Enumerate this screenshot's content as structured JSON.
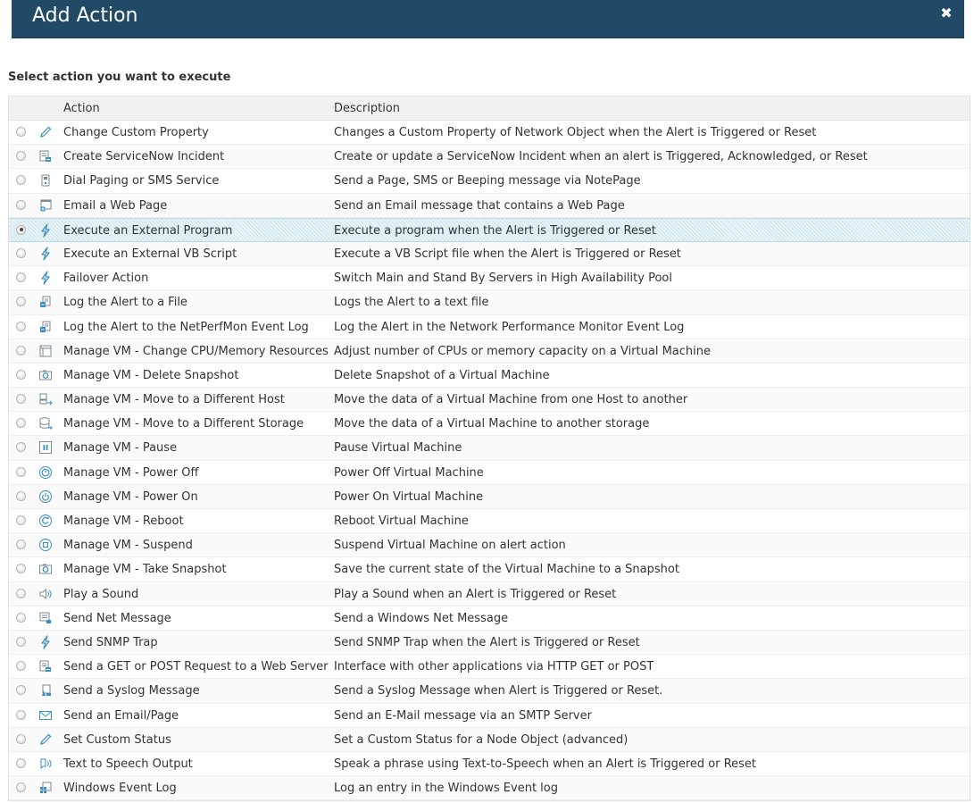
{
  "dialog": {
    "title": "Add Action",
    "close_icon": "close-icon",
    "instruction": "Select action you want to execute"
  },
  "table": {
    "columns": {
      "action": "Action",
      "description": "Description"
    },
    "selected_index": 4,
    "rows": [
      {
        "action": "Change Custom Property",
        "description": "Changes a Custom Property of Network Object when the Alert is Triggered or Reset",
        "icon": "pencil-icon"
      },
      {
        "action": "Create ServiceNow Incident",
        "description": "Create or update a ServiceNow Incident when an alert is Triggered, Acknowledged, or Reset",
        "icon": "incident-icon"
      },
      {
        "action": "Dial Paging or SMS Service",
        "description": "Send a Page, SMS or Beeping message via NotePage",
        "icon": "pager-icon"
      },
      {
        "action": "Email a Web Page",
        "description": "Send an Email message that contains a Web Page",
        "icon": "web-page-icon"
      },
      {
        "action": "Execute an External Program",
        "description": "Execute a program when the Alert is Triggered or Reset",
        "icon": "lightning-icon"
      },
      {
        "action": "Execute an External VB Script",
        "description": "Execute a VB Script file when the Alert is Triggered or Reset",
        "icon": "lightning-icon"
      },
      {
        "action": "Failover Action",
        "description": "Switch Main and Stand By Servers in High Availability Pool",
        "icon": "lightning-icon"
      },
      {
        "action": "Log the Alert to a File",
        "description": "Logs the Alert to a text file",
        "icon": "log-file-icon"
      },
      {
        "action": "Log the Alert to the NetPerfMon Event Log",
        "description": "Log the Alert in the Network Performance Monitor Event Log",
        "icon": "log-file-icon"
      },
      {
        "action": "Manage VM - Change CPU/Memory Resources",
        "description": "Adjust number of CPUs or memory capacity on a Virtual Machine",
        "icon": "vm-resources-icon"
      },
      {
        "action": "Manage VM - Delete Snapshot",
        "description": "Delete Snapshot of a Virtual Machine",
        "icon": "camera-icon"
      },
      {
        "action": "Manage VM - Move to a Different Host",
        "description": "Move the data of a Virtual Machine from one Host to another",
        "icon": "move-host-icon"
      },
      {
        "action": "Manage VM - Move to a Different Storage",
        "description": "Move the data of a Virtual Machine to another storage",
        "icon": "storage-icon"
      },
      {
        "action": "Manage VM - Pause",
        "description": "Pause Virtual Machine",
        "icon": "pause-icon"
      },
      {
        "action": "Manage VM - Power Off",
        "description": "Power Off Virtual Machine",
        "icon": "power-off-icon"
      },
      {
        "action": "Manage VM - Power On",
        "description": "Power On Virtual Machine",
        "icon": "power-on-icon"
      },
      {
        "action": "Manage VM - Reboot",
        "description": "Reboot Virtual Machine",
        "icon": "reboot-icon"
      },
      {
        "action": "Manage VM - Suspend",
        "description": "Suspend Virtual Machine on alert action",
        "icon": "suspend-icon"
      },
      {
        "action": "Manage VM - Take Snapshot",
        "description": "Save the current state of the Virtual Machine to a Snapshot",
        "icon": "camera-icon"
      },
      {
        "action": "Play a Sound",
        "description": "Play a Sound when an Alert is Triggered or Reset",
        "icon": "speaker-icon"
      },
      {
        "action": "Send Net Message",
        "description": "Send a Windows Net Message",
        "icon": "net-message-icon"
      },
      {
        "action": "Send SNMP Trap",
        "description": "Send SNMP Trap when the Alert is Triggered or Reset",
        "icon": "lightning-icon"
      },
      {
        "action": "Send a GET or POST Request to a Web Server",
        "description": "Interface with other applications via HTTP GET or POST",
        "icon": "incident-icon"
      },
      {
        "action": "Send a Syslog Message",
        "description": "Send a Syslog Message when Alert is Triggered or Reset.",
        "icon": "syslog-icon"
      },
      {
        "action": "Send an Email/Page",
        "description": "Send an E-Mail message via an SMTP Server",
        "icon": "envelope-icon"
      },
      {
        "action": "Set Custom Status",
        "description": "Set a Custom Status for a Node Object (advanced)",
        "icon": "pencil-icon"
      },
      {
        "action": "Text to Speech Output",
        "description": "Speak a phrase using Text-to-Speech when an Alert is Triggered or Reset",
        "icon": "speech-icon"
      },
      {
        "action": "Windows Event Log",
        "description": "Log an entry in the Windows Event log",
        "icon": "windows-log-icon"
      }
    ]
  }
}
